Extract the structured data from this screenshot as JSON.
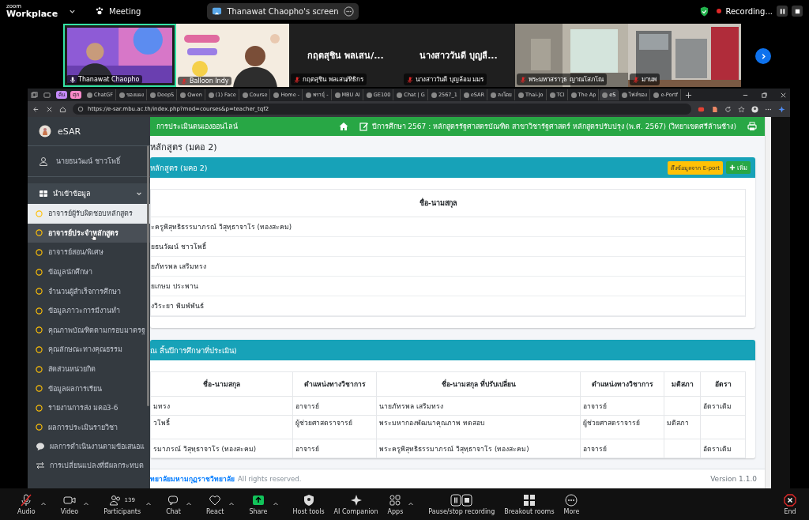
{
  "zoom_bar": {
    "brand_small": "zoom",
    "brand": "Workplace",
    "meeting": "Meeting",
    "share_title": "Thanawat Chaopho's screen",
    "recording": "Recording..."
  },
  "participants": [
    {
      "kind": "picture",
      "name": "Thanawat Chaopho",
      "muted": false,
      "speaking": true
    },
    {
      "kind": "picture",
      "name": "Balloon Indy",
      "muted": true,
      "speaking": false
    },
    {
      "kind": "name",
      "display": "กฤตสุชิน พลเสน/...",
      "name": "กฤตสุชิน พลเสน/ทิธิกร",
      "muted": true,
      "speaking": false
    },
    {
      "kind": "name",
      "display": "นางสาววันดี บุญลื...",
      "name": "นางสาววันดี บุญล้อม มมร",
      "muted": true,
      "speaking": false
    },
    {
      "kind": "picture",
      "name": "พระมหาสราวุธ ญาณโสภโณ",
      "muted": true,
      "speaking": false
    },
    {
      "kind": "picture",
      "name": "มานพ",
      "muted": true,
      "speaking": false
    }
  ],
  "browser": {
    "tab_groups": [
      {
        "label": "ค้น",
        "color": "#c58af9"
      },
      {
        "label": "ศุภ",
        "color": "#ff8bcb"
      }
    ],
    "tabs": [
      {
        "label": "ChatGF",
        "selected": false
      },
      {
        "label": "ของแผง",
        "selected": false
      },
      {
        "label": "DeepS",
        "selected": false
      },
      {
        "label": "Qwen",
        "selected": false
      },
      {
        "label": "(1) Face",
        "selected": false
      },
      {
        "label": "Course",
        "selected": false
      },
      {
        "label": "Home -",
        "selected": false
      },
      {
        "label": "พรายุ์ -",
        "selected": false
      },
      {
        "label": "MBU AI",
        "selected": false
      },
      {
        "label": "GE100",
        "selected": false
      },
      {
        "label": "Chat | G",
        "selected": false
      },
      {
        "label": "2567_1",
        "selected": false
      },
      {
        "label": "eSAR",
        "selected": false
      },
      {
        "label": "ลงโดย",
        "selected": false
      },
      {
        "label": "Thai-Jo",
        "selected": false
      },
      {
        "label": "TCI",
        "selected": false
      },
      {
        "label": "The Ap",
        "selected": false
      },
      {
        "label": "eS",
        "selected": true
      },
      {
        "label": "ไฟล์ของ",
        "selected": false
      },
      {
        "label": "e-Portf",
        "selected": false
      }
    ],
    "url": "https://e-sar.mbu.ac.th/index.php?mod=courses&p=teacher_tqf2"
  },
  "sidebar": {
    "brand": "eSAR",
    "user": "นายธนวัฒน์ ชาวโพธิ์",
    "section": {
      "label": "นำเข้าข้อมูล",
      "expanded": true
    },
    "items": [
      {
        "label": "อาจารย์ผู้รับผิดชอบหลักสูตร",
        "selected": true,
        "hovered": false
      },
      {
        "label": "อาจารย์ประจำหลักสูตร",
        "selected": false,
        "hovered": true
      },
      {
        "label": "อาจารย์สอน/พิเศษ",
        "selected": false,
        "hovered": false
      },
      {
        "label": "ข้อมูลนักศึกษา",
        "selected": false,
        "hovered": false
      },
      {
        "label": "จำนวนผู้สำเร็จการศึกษา",
        "selected": false,
        "hovered": false
      },
      {
        "label": "ข้อมูลภาวะการมีงานทำ",
        "selected": false,
        "hovered": false
      },
      {
        "label": "คุณภาพบัณฑิตตามกรอบมาตรฐ",
        "selected": false,
        "hovered": false
      },
      {
        "label": "คุณลักษณะทางคุณธรรม",
        "selected": false,
        "hovered": false
      },
      {
        "label": "สัดส่วนหน่วยกิต",
        "selected": false,
        "hovered": false
      },
      {
        "label": "ข้อมูลผลการเรียน",
        "selected": false,
        "hovered": false
      },
      {
        "label": "รายงานการส่ง มคอ3-6",
        "selected": false,
        "hovered": false
      },
      {
        "label": "ผลการประเมินรายวิชา",
        "selected": false,
        "hovered": false
      }
    ],
    "more": [
      {
        "kind": "comment",
        "label": "ผลการดำเนินงานตามข้อเสนอแ"
      },
      {
        "kind": "exchange",
        "label": "การเปลี่ยนแปลงที่มีผลกระทบต"
      }
    ]
  },
  "header": {
    "title": "การประเมินตนเองออนไลน์",
    "year": "ปีการศึกษา 2567 : หลักสูตรรัฐศาสตรบัณฑิต สาขาวิชารัฐศาสตร์ หลักสูตรปรับปรุง (พ.ศ. 2567) (วิทยาเขตศรีล้านช้าง)"
  },
  "page_title": "หลักสูตร (มคอ 2)",
  "card1": {
    "title": "หลักสูตร (มคอ 2)",
    "import_button": "ดึงข้อมูลจาก E-port",
    "add_button": "เพิ่ม",
    "column": "ชื่อ-นามสกุล",
    "rows": [
      "ะครูพิสุทธิธรรมาภรณ์ วิสุทฺธาจาโร (ทองสะคม)",
      "ยธนวัฒน์ ชาวโพธิ์",
      "ยภัทรพล เสริมทรง",
      "ยเกษม ประพาน",
      "งวิระยา พิมพ์พันธ์"
    ]
  },
  "card2": {
    "title": "ณ สิ้นปีการศึกษาที่ประเมิน)",
    "columns": [
      "ชื่อ-นามสกุล",
      "ตำแหน่งทางวิชาการ",
      "ชื่อ-นามสกุล ที่ปรับเปลี่ยน",
      "ตำแหน่งทางวิชาการ",
      "มติสภา",
      "อัตรา"
    ],
    "rows": [
      [
        "มทรง",
        "อาจารย์",
        "นายภัทรพล เสริมทรง",
        "อาจารย์",
        "",
        "อัตราเดิม"
      ],
      [
        "วโพธิ์",
        "ผู้ช่วยศาสตราจารย์",
        "พระมหากองพัฒนาคุณภาพ ทดสอบ",
        "ผู้ช่วยศาสตราจารย์",
        "มติสภา",
        ""
      ],
      [
        "รมาภรณ์ วิสุทฺธาจาโร (ทองสะคม)",
        "อาจารย์",
        "พระครูพิสุทธิธรรมาภรณ์ วิสุทฺธาจาโร (ทองสะคม)",
        "อาจารย์",
        "",
        "อัตราเดิม"
      ]
    ]
  },
  "footer": {
    "link": "ทยาลัยมหามกุฏราชวิทยาลัย",
    "text": "All rights reserved.",
    "version": "Version 1.1.0"
  },
  "toolbar": {
    "items": [
      {
        "kind": "audio",
        "label": "Audio",
        "muted": true
      },
      {
        "kind": "video",
        "label": "Video"
      },
      {
        "kind": "participants",
        "label": "Participants",
        "count": "139"
      },
      {
        "kind": "chat",
        "label": "Chat"
      },
      {
        "kind": "react",
        "label": "React"
      },
      {
        "kind": "share",
        "label": "Share"
      },
      {
        "kind": "host",
        "label": "Host tools"
      },
      {
        "kind": "ai",
        "label": "AI Companion"
      },
      {
        "kind": "apps",
        "label": "Apps"
      },
      {
        "kind": "record",
        "label": "Pause/stop recording"
      },
      {
        "kind": "breakout",
        "label": "Breakout rooms"
      },
      {
        "kind": "more",
        "label": "More"
      }
    ],
    "end": "End"
  }
}
